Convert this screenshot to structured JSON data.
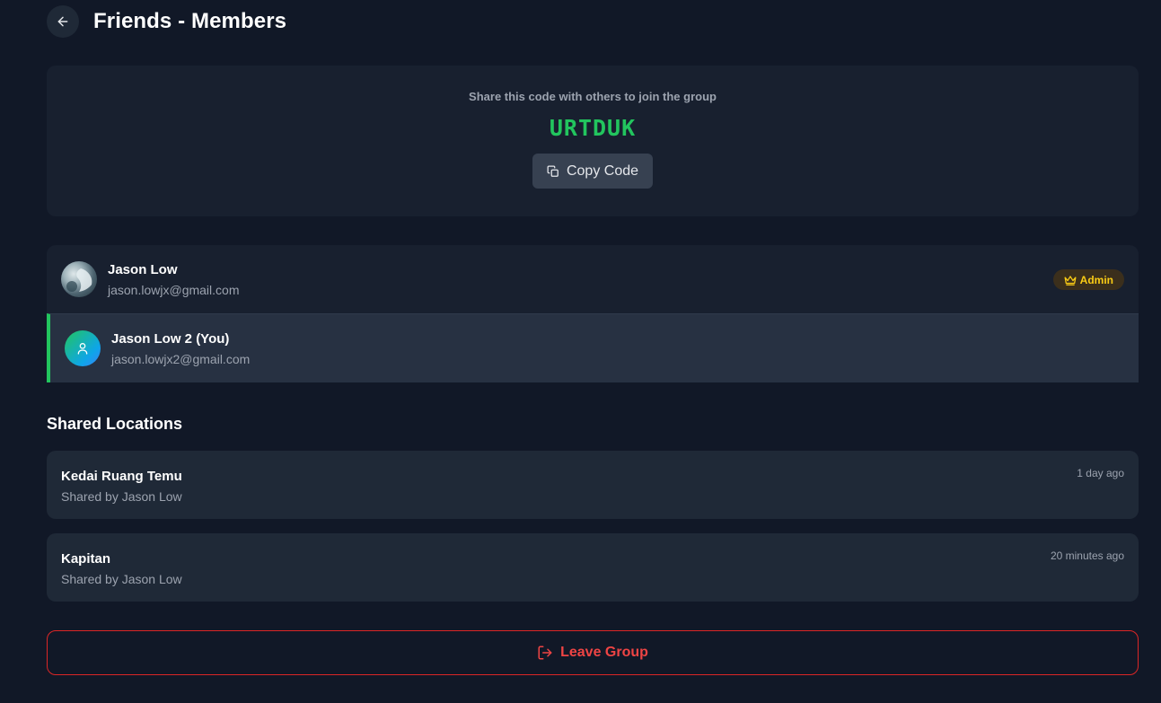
{
  "header": {
    "title": "Friends - Members",
    "back_icon": "arrow-left-icon"
  },
  "share": {
    "instruction": "Share this code with others to join the group",
    "code": "URTDUK",
    "copy_label": "Copy Code",
    "copy_icon": "copy-icon"
  },
  "members": [
    {
      "name": "Jason Low",
      "email": "jason.lowjx@gmail.com",
      "badge": "Admin",
      "badge_icon": "crown-icon",
      "avatar": "photo"
    },
    {
      "name": "Jason Low 2 (You)",
      "email": "jason.lowjx2@gmail.com",
      "avatar": "default-user-icon"
    }
  ],
  "locations": {
    "title": "Shared Locations",
    "items": [
      {
        "name": "Kedai Ruang Temu",
        "shared_by": "Shared by Jason Low",
        "time": "1 day ago"
      },
      {
        "name": "Kapitan",
        "shared_by": "Shared by Jason Low",
        "time": "20 minutes ago"
      }
    ]
  },
  "leave": {
    "label": "Leave Group",
    "icon": "logout-icon"
  },
  "colors": {
    "accent": "#22c55e",
    "danger": "#ef4444",
    "admin": "#facc15",
    "background": "#111827"
  }
}
